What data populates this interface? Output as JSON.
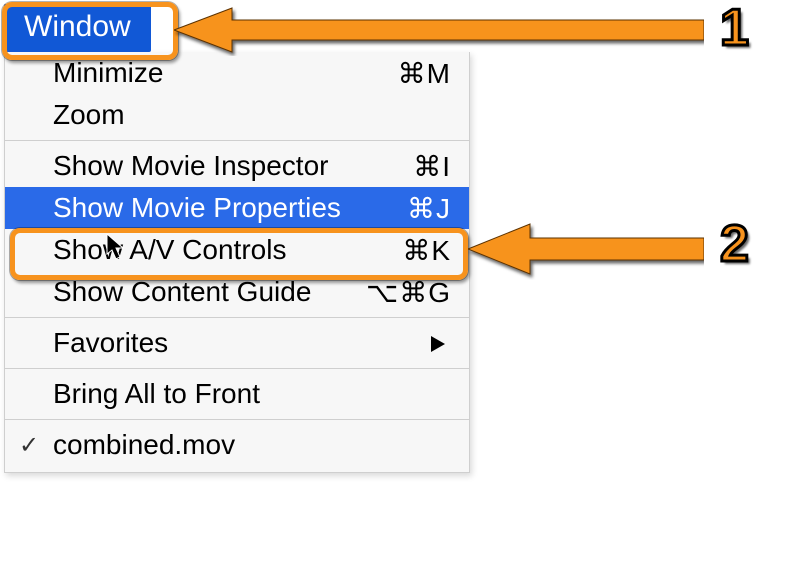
{
  "menu": {
    "title": "Window",
    "groups": [
      [
        {
          "label": "Minimize",
          "shortcut": "⌘M",
          "highlight": false,
          "check": false,
          "submenu": false
        },
        {
          "label": "Zoom",
          "shortcut": "",
          "highlight": false,
          "check": false,
          "submenu": false
        }
      ],
      [
        {
          "label": "Show Movie Inspector",
          "shortcut": "⌘I",
          "highlight": false,
          "check": false,
          "submenu": false
        },
        {
          "label": "Show Movie Properties",
          "shortcut": "⌘J",
          "highlight": true,
          "check": false,
          "submenu": false
        },
        {
          "label": "Show A/V Controls",
          "shortcut": "⌘K",
          "highlight": false,
          "check": false,
          "submenu": false
        },
        {
          "label": "Show Content Guide",
          "shortcut": "⌥⌘G",
          "highlight": false,
          "check": false,
          "submenu": false
        }
      ],
      [
        {
          "label": "Favorites",
          "shortcut": "",
          "highlight": false,
          "check": false,
          "submenu": true
        }
      ],
      [
        {
          "label": "Bring All to Front",
          "shortcut": "",
          "highlight": false,
          "check": false,
          "submenu": false
        }
      ],
      [
        {
          "label": "combined.mov",
          "shortcut": "",
          "highlight": false,
          "check": true,
          "submenu": false
        }
      ]
    ]
  },
  "annotations": {
    "step1": "1",
    "step2": "2"
  }
}
